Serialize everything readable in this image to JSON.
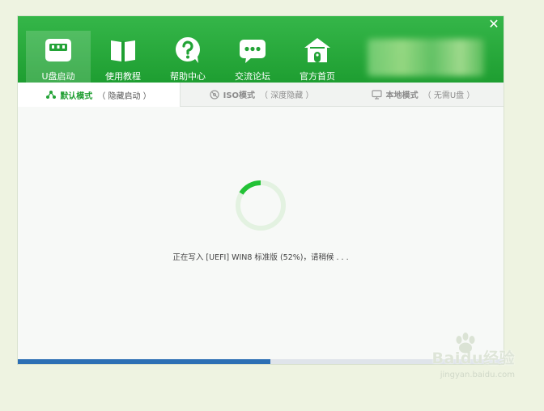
{
  "window": {
    "close_icon": "close-icon"
  },
  "nav": {
    "items": [
      {
        "label": "U盘启动",
        "icon": "usb-drive-icon",
        "active": true
      },
      {
        "label": "使用教程",
        "icon": "book-icon",
        "active": false
      },
      {
        "label": "帮助中心",
        "icon": "question-bubble-icon",
        "active": false
      },
      {
        "label": "交流论坛",
        "icon": "chat-bubble-icon",
        "active": false
      },
      {
        "label": "官方首页",
        "icon": "home-icon",
        "active": false
      }
    ]
  },
  "tabs": [
    {
      "title": "默认模式",
      "subtitle": "（ 隐藏启动 ）",
      "icon": "share-nodes-icon",
      "active": true
    },
    {
      "title": "ISO模式",
      "subtitle": "（ 深度隐藏 ）",
      "icon": "disc-icon",
      "active": false
    },
    {
      "title": "本地模式",
      "subtitle": "（ 无需U盘 ）",
      "icon": "monitor-icon",
      "active": false
    }
  ],
  "status": {
    "message": "正在写入 [UEFI] WIN8 标准版 (52%)，请稍候 . . .",
    "progress_fraction": 0.52
  },
  "colors": {
    "brand_green": "#22a336",
    "progress_blue": "#2c6fb4",
    "spinner_track": "#e3f2e1"
  },
  "watermark": {
    "brand": "Baidu经验",
    "url": "jingyan.baidu.com"
  }
}
